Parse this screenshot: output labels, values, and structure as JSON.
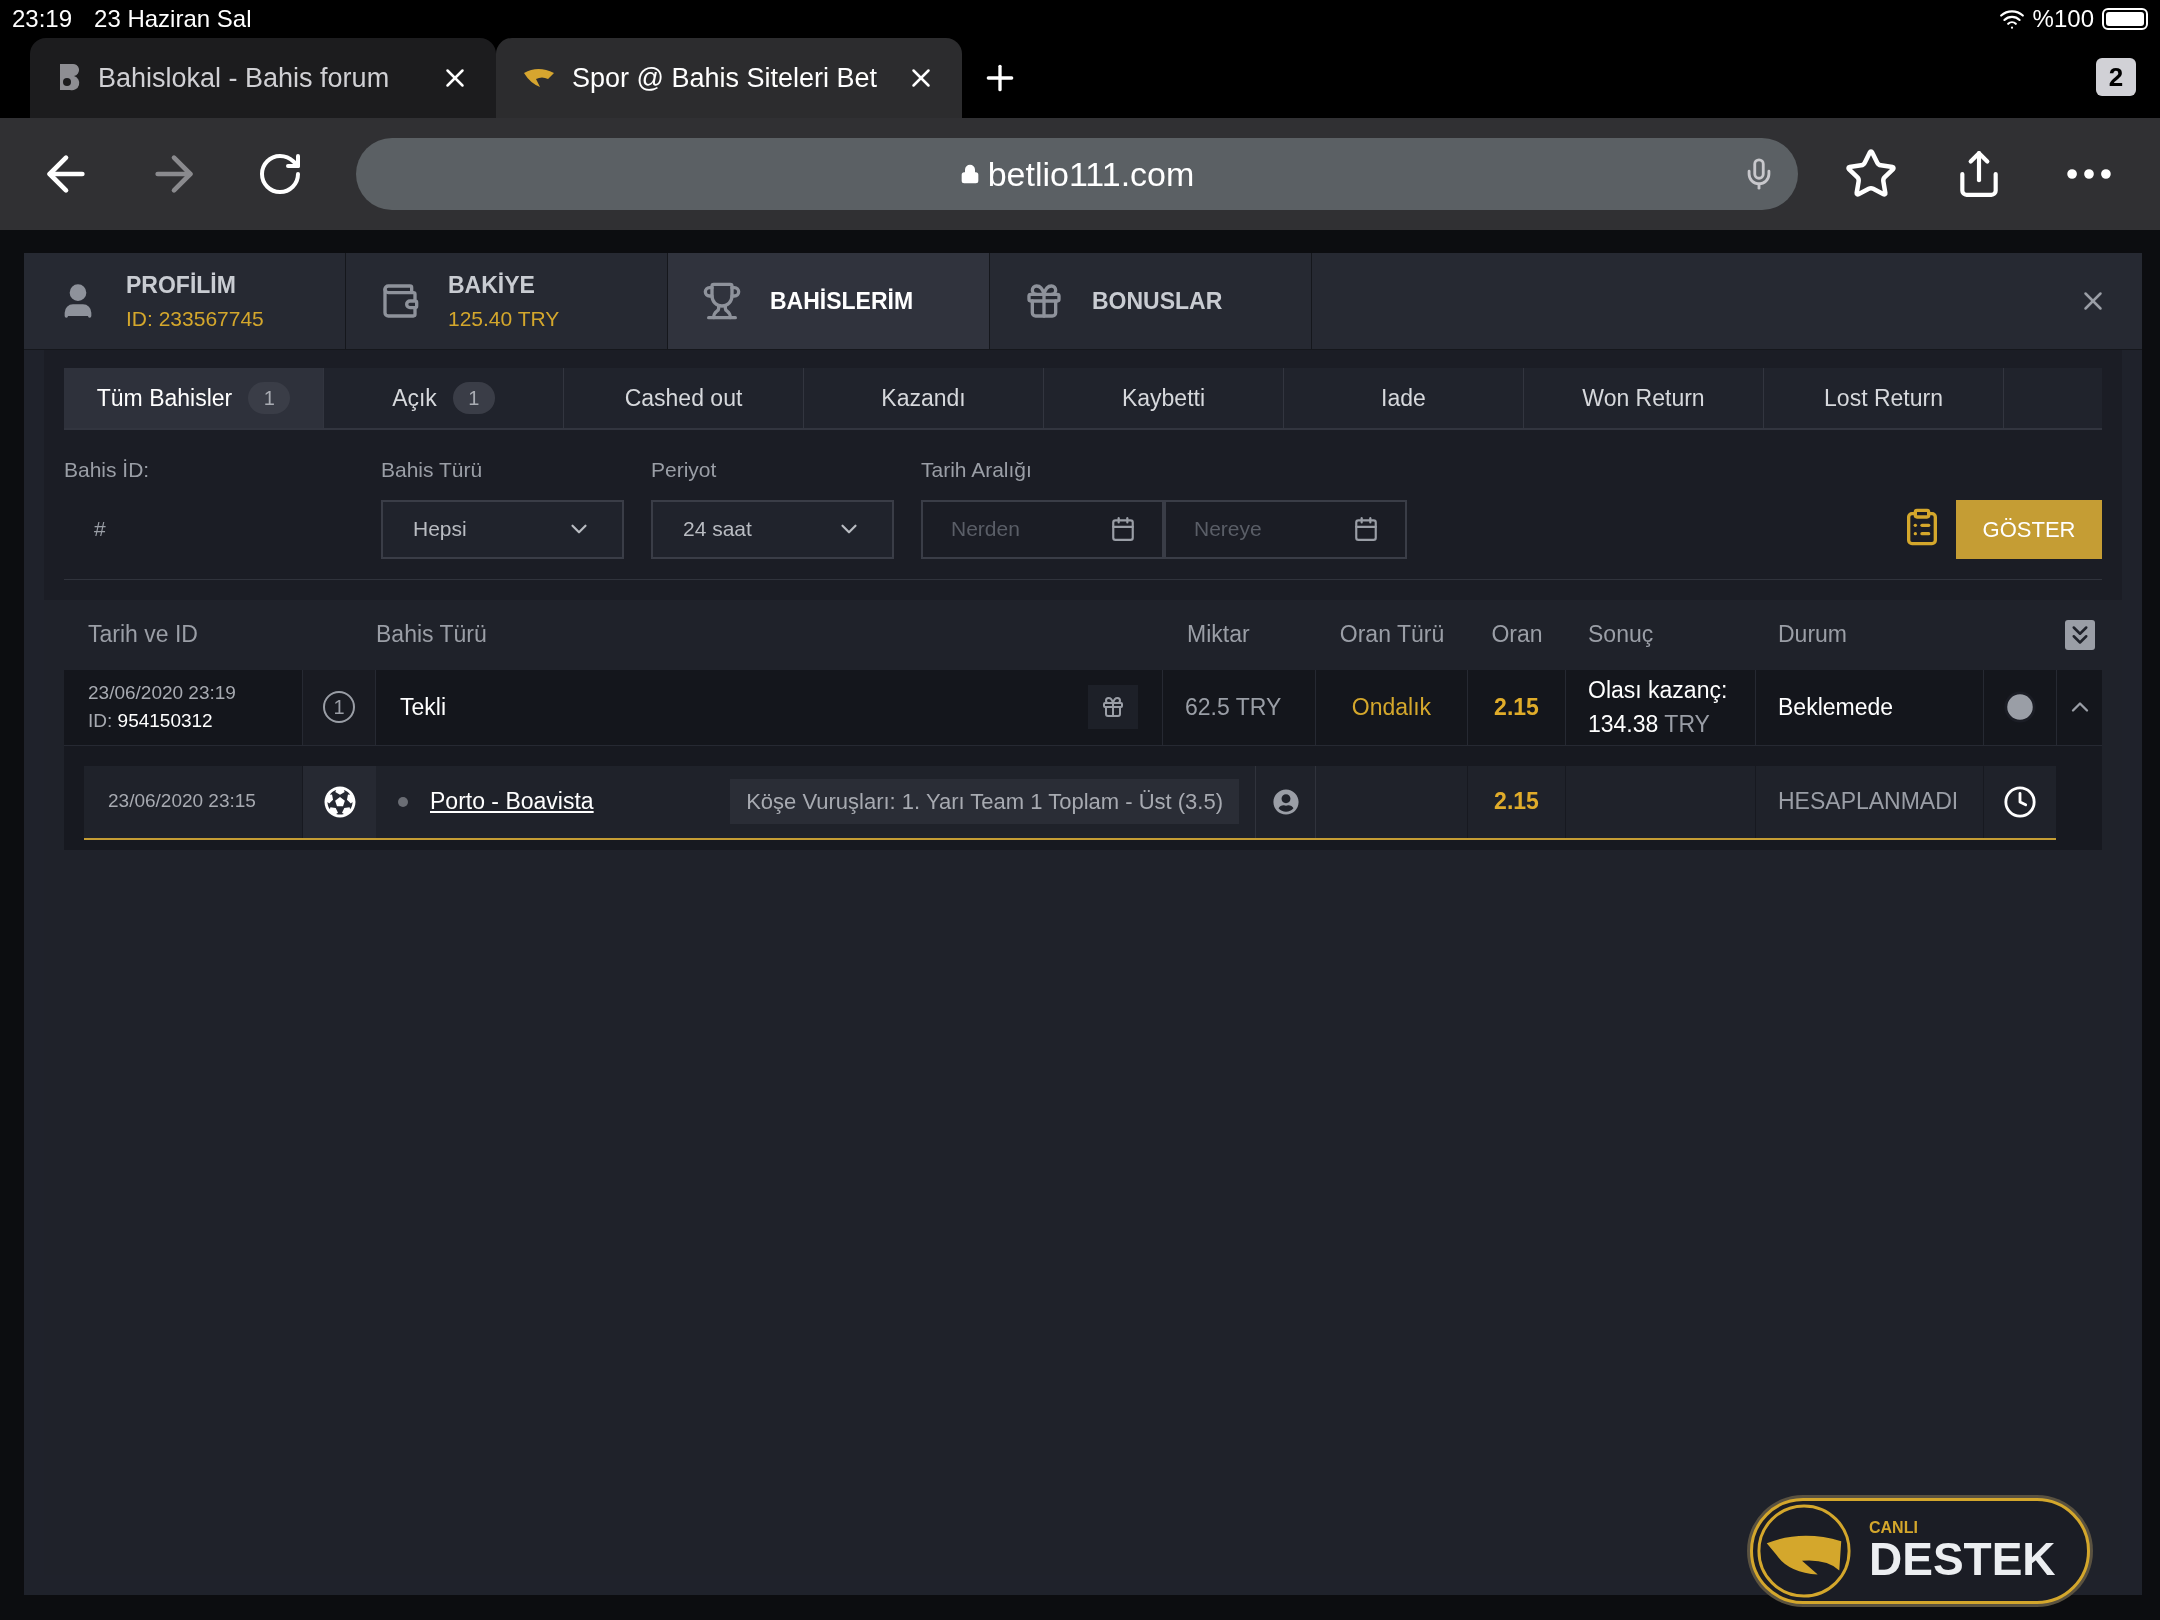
{
  "status_bar": {
    "time": "23:19",
    "date": "23 Haziran Sal",
    "battery": "%100"
  },
  "browser": {
    "tabs": [
      {
        "title": "Bahislokal - Bahis forum",
        "selected": false
      },
      {
        "title": "Spor @ Bahis Siteleri Bet",
        "selected": true
      }
    ],
    "tab_count": "2",
    "forward_disabled": true,
    "url": "betlio111.com"
  },
  "modal": {
    "nav": [
      {
        "kind": "profile",
        "title": "PROFİLİM",
        "subtitle": "ID: 233567745",
        "selected": false
      },
      {
        "kind": "wallet",
        "title": "BAKİYE",
        "subtitle": "125.40 TRY",
        "selected": false
      },
      {
        "kind": "trophy",
        "title": "BAHİSLERİM",
        "selected": true
      },
      {
        "kind": "gift",
        "title": "BONUSLAR",
        "selected": false
      }
    ],
    "sub_tabs": [
      {
        "label": "Tüm Bahisler",
        "count": "1",
        "selected": true
      },
      {
        "label": "Açık",
        "count": "1",
        "selected": false
      },
      {
        "label": "Cashed out",
        "selected": false
      },
      {
        "label": "Kazandı",
        "selected": false
      },
      {
        "label": "Kaybetti",
        "selected": false
      },
      {
        "label": "Iade",
        "selected": false
      },
      {
        "label": "Won Return",
        "selected": false
      },
      {
        "label": "Lost Return",
        "selected": false
      }
    ],
    "filters": {
      "bet_id": {
        "label": "Bahis İD:",
        "placeholder": "#"
      },
      "bet_type": {
        "label": "Bahis Türü",
        "value": "Hepsi"
      },
      "period": {
        "label": "Periyot",
        "value": "24 saat"
      },
      "date_range": {
        "label": "Tarih Aralığı",
        "from_placeholder": "Nerden",
        "to_placeholder": "Nereye"
      },
      "submit": "GÖSTER"
    },
    "table": {
      "columns": [
        "Tarih ve ID",
        "Bahis Türü",
        "Miktar",
        "Oran Türü",
        "Oran",
        "Sonuç",
        "Durum"
      ],
      "rows": [
        {
          "date": "23/06/2020 23:19",
          "id_label": "ID:",
          "id": "954150312",
          "count": "1",
          "type": "Tekli",
          "amount": "62.5",
          "currency": "TRY",
          "odds_type": "Ondalık",
          "odds": "2.15",
          "result_label": "Olası kazanç:",
          "result_amount": "134.38",
          "result_currency": "TRY",
          "status": "Beklemede",
          "expanded": true,
          "selections": [
            {
              "date": "23/06/2020 23:15",
              "event": "Porto - Boavista",
              "market": "Köşe Vuruşları: 1. Yarı Team 1 Toplam - Üst (3.5)",
              "odds": "2.15",
              "status": "HESAPLANMADI"
            }
          ]
        }
      ]
    }
  },
  "support": {
    "small": "CANLI",
    "big": "DESTEK"
  }
}
